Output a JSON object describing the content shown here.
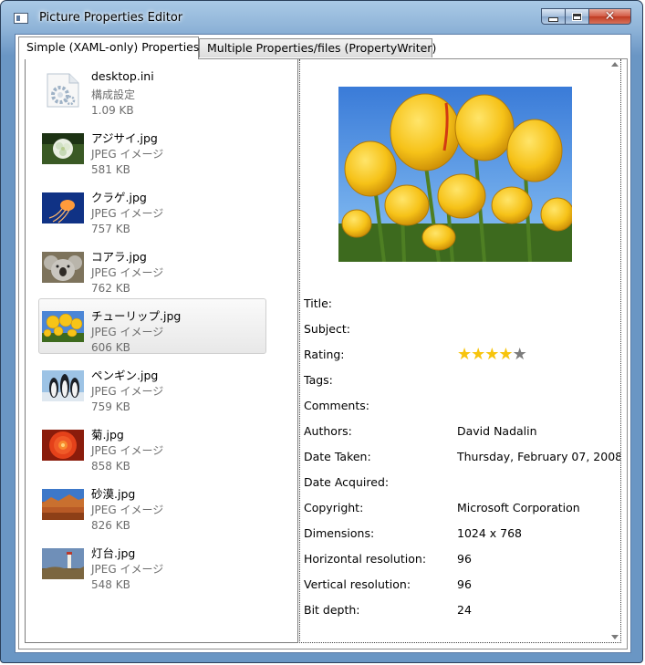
{
  "window": {
    "title": "Picture Properties Editor"
  },
  "tabs": [
    {
      "label": "Simple (XAML-only) Properties",
      "active": true
    },
    {
      "label": "Multiple Properties/files (PropertyWriter)",
      "active": false
    }
  ],
  "files": [
    {
      "name": "desktop.ini",
      "type": "構成設定",
      "size": "1.09 KB",
      "icon": "config-file-icon"
    },
    {
      "name": "アジサイ.jpg",
      "type": "JPEG イメージ",
      "size": "581 KB",
      "icon": "hydrangea-thumbnail"
    },
    {
      "name": "クラゲ.jpg",
      "type": "JPEG イメージ",
      "size": "757 KB",
      "icon": "jellyfish-thumbnail"
    },
    {
      "name": "コアラ.jpg",
      "type": "JPEG イメージ",
      "size": "762 KB",
      "icon": "koala-thumbnail"
    },
    {
      "name": "チューリップ.jpg",
      "type": "JPEG イメージ",
      "size": "606 KB",
      "icon": "tulips-thumbnail",
      "selected": true
    },
    {
      "name": "ペンギン.jpg",
      "type": "JPEG イメージ",
      "size": "759 KB",
      "icon": "penguins-thumbnail"
    },
    {
      "name": "菊.jpg",
      "type": "JPEG イメージ",
      "size": "858 KB",
      "icon": "chrysanthemum-thumbnail"
    },
    {
      "name": "砂漠.jpg",
      "type": "JPEG イメージ",
      "size": "826 KB",
      "icon": "desert-thumbnail"
    },
    {
      "name": "灯台.jpg",
      "type": "JPEG イメージ",
      "size": "548 KB",
      "icon": "lighthouse-thumbnail"
    }
  ],
  "details": {
    "preview_icon": "tulips-preview-image",
    "rating_value": 4,
    "rating_max": 5,
    "colors": {
      "star_on": "#f7c40d",
      "star_off": "#7c7c7c"
    },
    "properties": [
      {
        "label": "Title:",
        "value": ""
      },
      {
        "label": "Subject:",
        "value": ""
      },
      {
        "label": "Rating:",
        "value": ""
      },
      {
        "label": "Tags:",
        "value": ""
      },
      {
        "label": "Comments:",
        "value": ""
      },
      {
        "label": "Authors:",
        "value": "David Nadalin"
      },
      {
        "label": "Date Taken:",
        "value": "Thursday, February 07, 2008"
      },
      {
        "label": "Date Acquired:",
        "value": ""
      },
      {
        "label": "Copyright:",
        "value": "Microsoft Corporation"
      },
      {
        "label": "Dimensions:",
        "value": "1024 x 768"
      },
      {
        "label": "Horizontal resolution:",
        "value": "96"
      },
      {
        "label": "Vertical resolution:",
        "value": "96"
      },
      {
        "label": "Bit depth:",
        "value": "24"
      }
    ]
  }
}
